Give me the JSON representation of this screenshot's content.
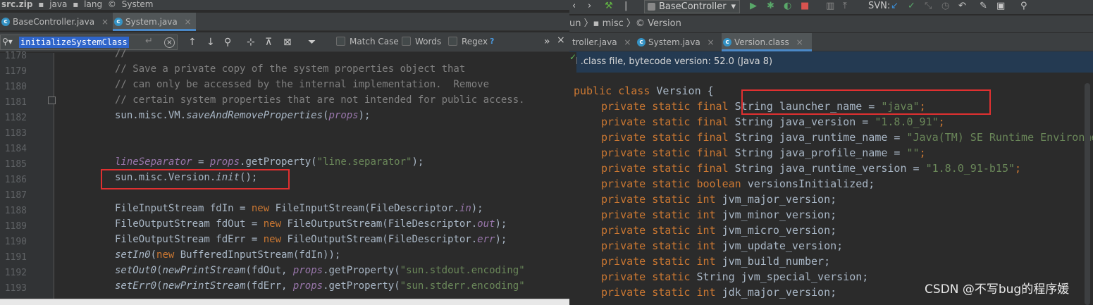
{
  "left": {
    "breadcrumb": [
      "src.zip",
      "java",
      "lang",
      "System"
    ],
    "tabs": [
      {
        "label": "BaseController.java",
        "icon": "C",
        "active": false
      },
      {
        "label": "System.java",
        "icon": "C",
        "active": true
      }
    ],
    "search": {
      "query": "initializeSystemClass",
      "match_case_label": "Match Case",
      "words_label": "Words",
      "regex_label": "Regex",
      "help": "?"
    },
    "line_numbers": [
      "1178",
      "1179",
      "1180",
      "1181",
      "1182",
      "1183",
      "1184",
      "1185",
      "1186",
      "1187",
      "1188",
      "1189",
      "1190",
      "1191",
      "1192",
      "1193"
    ],
    "code": [
      {
        "type": "comment",
        "text": "//"
      },
      {
        "type": "comment",
        "text": "// Save a private copy of the system properties object that"
      },
      {
        "type": "comment",
        "text": "// can only be accessed by the internal implementation.  Remove"
      },
      {
        "type": "comment",
        "text": "// certain system properties that are not intended for public access."
      },
      {
        "type": "plain",
        "a": "sun.misc.VM.",
        "b": "saveAndRemoveProperties",
        "c": "(",
        "d": "props",
        "e": ");"
      },
      {
        "type": "blank"
      },
      {
        "type": "blank"
      },
      {
        "type": "sep",
        "a": "lineSeparator",
        "b": " = ",
        "c": "props",
        "d": ".getProperty(",
        "e": "\"line.separator\"",
        "f": ");"
      },
      {
        "type": "init",
        "a": "sun.misc.Version.",
        "b": "init",
        "c": "();"
      },
      {
        "type": "blank"
      },
      {
        "type": "stream",
        "a": "FileInputStream fdIn = ",
        "b": "new",
        "c": " FileInputStream(FileDescriptor.",
        "d": "in",
        "e": ");"
      },
      {
        "type": "stream",
        "a": "FileOutputStream fdOut = ",
        "b": "new",
        "c": " FileOutputStream(FileDescriptor.",
        "d": "out",
        "e": ");"
      },
      {
        "type": "stream",
        "a": "FileOutputStream fdErr = ",
        "b": "new",
        "c": " FileOutputStream(FileDescriptor.",
        "d": "err",
        "e": ");"
      },
      {
        "type": "setin",
        "a": "setIn0",
        "b": "(",
        "c": "new",
        "d": " BufferedInputStream(fdIn));"
      },
      {
        "type": "setout",
        "a": "setOut0",
        "b": "(",
        "c": "newPrintStream",
        "d": "(fdOut, ",
        "e": "props",
        "f": ".getProperty(",
        "g": "\"sun.stdout.encoding\""
      },
      {
        "type": "setout",
        "a": "setErr0",
        "b": "(",
        "c": "newPrintStream",
        "d": "(fdErr, ",
        "e": "props",
        "f": ".getProperty(",
        "g": "\"sun.stderr.encoding\""
      }
    ]
  },
  "right": {
    "run_config": "BaseController",
    "svn_label": "SVN:",
    "breadcrumb": [
      "un",
      "misc",
      "Version"
    ],
    "tabs": [
      {
        "label": "troller.java",
        "icon": "C",
        "active": false
      },
      {
        "label": "System.java",
        "icon": "C",
        "active": false
      },
      {
        "label": "Version.class",
        "icon": "C",
        "active": true
      }
    ],
    "info": "l .class file, bytecode version: 52.0 (Java 8)",
    "class_decl": {
      "kw": "public class",
      "name": " Version {"
    },
    "fields": [
      {
        "mods": "private static final",
        "type": "String",
        "rest": " launcher_name = ",
        "val": "\"java\"",
        "end": ";"
      },
      {
        "mods": "private static final",
        "type": "String",
        "rest": " java_version = ",
        "val": "\"1.8.0_91\"",
        "end": ";"
      },
      {
        "mods": "private static final",
        "type": "String",
        "rest": " java_runtime_name = ",
        "val": "\"Java(TM) SE Runtime Environment\"",
        "end": ";"
      },
      {
        "mods": "private static final",
        "type": "String",
        "rest": " java_profile_name = ",
        "val": "\"\"",
        "end": ";"
      },
      {
        "mods": "private static final",
        "type": "String",
        "rest": " java_runtime_version = ",
        "val": "\"1.8.0_91-b15\"",
        "end": ";"
      },
      {
        "mods": "private static boolean",
        "type": "",
        "rest": " versionsInitialized;",
        "val": "",
        "end": ""
      },
      {
        "mods": "private static int",
        "type": "",
        "rest": " jvm_major_version;",
        "val": "",
        "end": ""
      },
      {
        "mods": "private static int",
        "type": "",
        "rest": " jvm_minor_version;",
        "val": "",
        "end": ""
      },
      {
        "mods": "private static int",
        "type": "",
        "rest": " jvm_micro_version;",
        "val": "",
        "end": ""
      },
      {
        "mods": "private static int",
        "type": "",
        "rest": " jvm_update_version;",
        "val": "",
        "end": ""
      },
      {
        "mods": "private static int",
        "type": "",
        "rest": " jvm_build_number;",
        "val": "",
        "end": ""
      },
      {
        "mods": "private static",
        "type": "String",
        "rest": " jvm_special_version;",
        "val": "",
        "end": ""
      },
      {
        "mods": "private static int",
        "type": "",
        "rest": " jdk_major_version;",
        "val": "",
        "end": ""
      }
    ]
  },
  "watermark": "CSDN @不写bug的程序媛",
  "colors": {
    "highlight_box": "#e03030",
    "keyword": "#cc7832",
    "string": "#6a8759",
    "comment": "#808080",
    "selection": "#2f65ca"
  }
}
